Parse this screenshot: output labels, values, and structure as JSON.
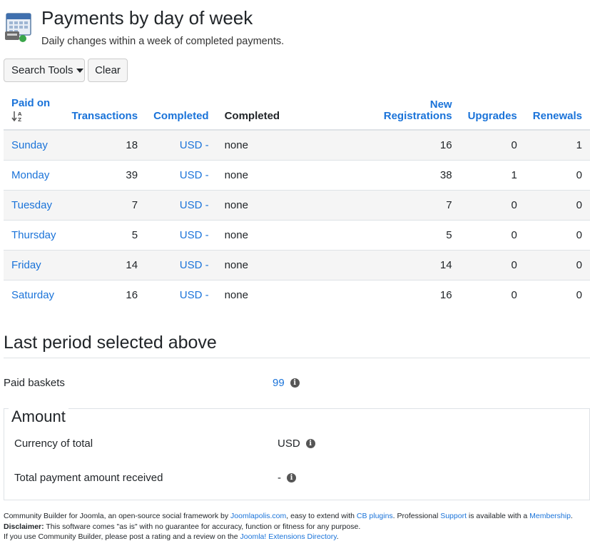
{
  "header": {
    "title": "Payments by day of week",
    "subtitle": "Daily changes within a week of completed payments."
  },
  "toolbar": {
    "search_tools_label": "Search Tools",
    "clear_label": "Clear"
  },
  "table": {
    "columns": {
      "paid_on": "Paid on",
      "transactions": "Transactions",
      "completed_link": "Completed",
      "completed": "Completed",
      "new_registrations_line1": "New",
      "new_registrations_line2": "Registrations",
      "upgrades": "Upgrades",
      "renewals": "Renewals"
    },
    "rows": [
      {
        "day": "Sunday",
        "transactions": "18",
        "currency": "USD -",
        "completed": "none",
        "new_registrations": "16",
        "upgrades": "0",
        "renewals": "1"
      },
      {
        "day": "Monday",
        "transactions": "39",
        "currency": "USD -",
        "completed": "none",
        "new_registrations": "38",
        "upgrades": "1",
        "renewals": "0"
      },
      {
        "day": "Tuesday",
        "transactions": "7",
        "currency": "USD -",
        "completed": "none",
        "new_registrations": "7",
        "upgrades": "0",
        "renewals": "0"
      },
      {
        "day": "Thursday",
        "transactions": "5",
        "currency": "USD -",
        "completed": "none",
        "new_registrations": "5",
        "upgrades": "0",
        "renewals": "0"
      },
      {
        "day": "Friday",
        "transactions": "14",
        "currency": "USD -",
        "completed": "none",
        "new_registrations": "14",
        "upgrades": "0",
        "renewals": "0"
      },
      {
        "day": "Saturday",
        "transactions": "16",
        "currency": "USD -",
        "completed": "none",
        "new_registrations": "16",
        "upgrades": "0",
        "renewals": "0"
      }
    ]
  },
  "summary": {
    "title": "Last period selected above",
    "paid_baskets_label": "Paid baskets",
    "paid_baskets_value": "99"
  },
  "amount": {
    "legend": "Amount",
    "currency_label": "Currency of total",
    "currency_value": "USD",
    "total_label": "Total payment amount received",
    "total_value": "-"
  },
  "footer": {
    "line1_prefix": "Community Builder for Joomla, an open-source social framework by ",
    "joomlapolis_link": "Joomlapolis.com",
    "line1_mid": ", easy to extend with ",
    "cb_plugins_link": "CB plugins",
    "line1_mid2": ". Professional ",
    "support_link": "Support",
    "line1_mid3": " is available with a ",
    "membership_link": "Membership",
    "line1_end": ".",
    "disclaimer_label": "Disclaimer:",
    "disclaimer_text": " This software comes \"as is\" with no guarantee for accuracy, function or fitness for any purpose.",
    "line3_prefix": "If you use Community Builder, please post a rating and a review on the ",
    "jed_link": "Joomla! Extensions Directory",
    "line3_end": "."
  },
  "colors": {
    "link": "#1a73d9",
    "stripe": "#f5f5f5",
    "border": "#dee2e6"
  },
  "icons": {
    "header": "calendar-icon",
    "sort": "sort-alpha-icon",
    "info": "info-icon",
    "dropdown": "caret-down-icon"
  }
}
